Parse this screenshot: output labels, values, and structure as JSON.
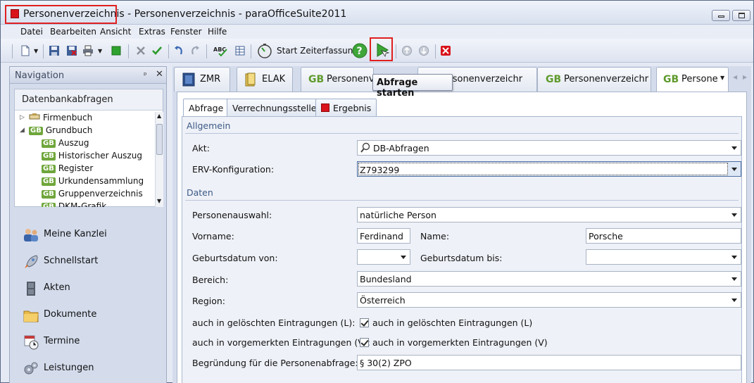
{
  "window": {
    "title_highlight": "Personenverzeichnis",
    "title_rest": " - Personenverzeichnis - paraOfficeSuite2011"
  },
  "menu": [
    "Datei",
    "Bearbeiten",
    "Ansicht",
    "Extras",
    "Fenster",
    "Hilfe"
  ],
  "toolbar": {
    "start_time_tracking": "Start Zeiterfassung",
    "tooltip": "Abfrage starten"
  },
  "navigation": {
    "title": "Navigation",
    "panel_title": "Datenbankabfragen",
    "tree": [
      {
        "label": "Firmenbuch",
        "prefix": "",
        "level": 0,
        "expander": "▷"
      },
      {
        "label": "Grundbuch",
        "prefix": "GB",
        "level": 0,
        "expander": "◢"
      },
      {
        "label": "Auszug",
        "prefix": "GB",
        "level": 1
      },
      {
        "label": "Historischer Auszug",
        "prefix": "GB",
        "level": 1
      },
      {
        "label": "Register",
        "prefix": "GB",
        "level": 1
      },
      {
        "label": "Urkundensammlung",
        "prefix": "GB",
        "level": 1
      },
      {
        "label": "Gruppenverzeichnis",
        "prefix": "GB",
        "level": 1
      },
      {
        "label": "DKM-Grafik",
        "prefix": "GB",
        "level": 1
      }
    ],
    "sections": [
      "Meine Kanzlei",
      "Schnellstart",
      "Akten",
      "Dokumente",
      "Termine",
      "Leistungen"
    ]
  },
  "doc_tabs": [
    {
      "prefix": "",
      "label": "ZMR"
    },
    {
      "prefix": "",
      "label": "ELAK"
    },
    {
      "prefix": "GB",
      "label": "Personenve"
    },
    {
      "prefix": "",
      "label": "Personenverzeichr"
    },
    {
      "prefix": "GB",
      "label": "Personenverzeichr"
    },
    {
      "prefix": "GB",
      "label": "Personer"
    }
  ],
  "sub_tabs": [
    "Abfrage",
    "Verrechnungsstelle",
    "Ergebnis"
  ],
  "form": {
    "group_general": "Allgemein",
    "akt_label": "Akt:",
    "akt_value": "DB-Abfragen",
    "erv_label": "ERV-Konfiguration:",
    "erv_value": "Z793299",
    "group_data": "Daten",
    "person_select_label": "Personenauswahl:",
    "person_select_value": "natürliche Person",
    "firstname_label": "Vorname:",
    "firstname_value": "Ferdinand",
    "lastname_label": "Name:",
    "lastname_value": "Porsche",
    "birth_from_label": "Geburtsdatum von:",
    "birth_from_value": "",
    "birth_to_label": "Geburtsdatum bis:",
    "birth_to_value": "",
    "area_label": "Bereich:",
    "area_value": "Bundesland",
    "region_label": "Region:",
    "region_value": "Österreich",
    "deleted_label": "auch in gelöschten Eintragungen (L):",
    "deleted_check_label": "auch in gelöschten Eintragungen (L)",
    "reserved_label": "auch in vorgemerkten Eintragungen (V):",
    "reserved_check_label": "auch in vorgemerkten Eintragungen (V)",
    "reason_label": "Begründung für die Personenabfrage:",
    "reason_value": "§ 30(2) ZPO"
  },
  "colors": {
    "highlight": "#e02020",
    "gb_green": "#6fa63b",
    "red_icon": "#d9141b",
    "play_green": "#3aa535"
  }
}
